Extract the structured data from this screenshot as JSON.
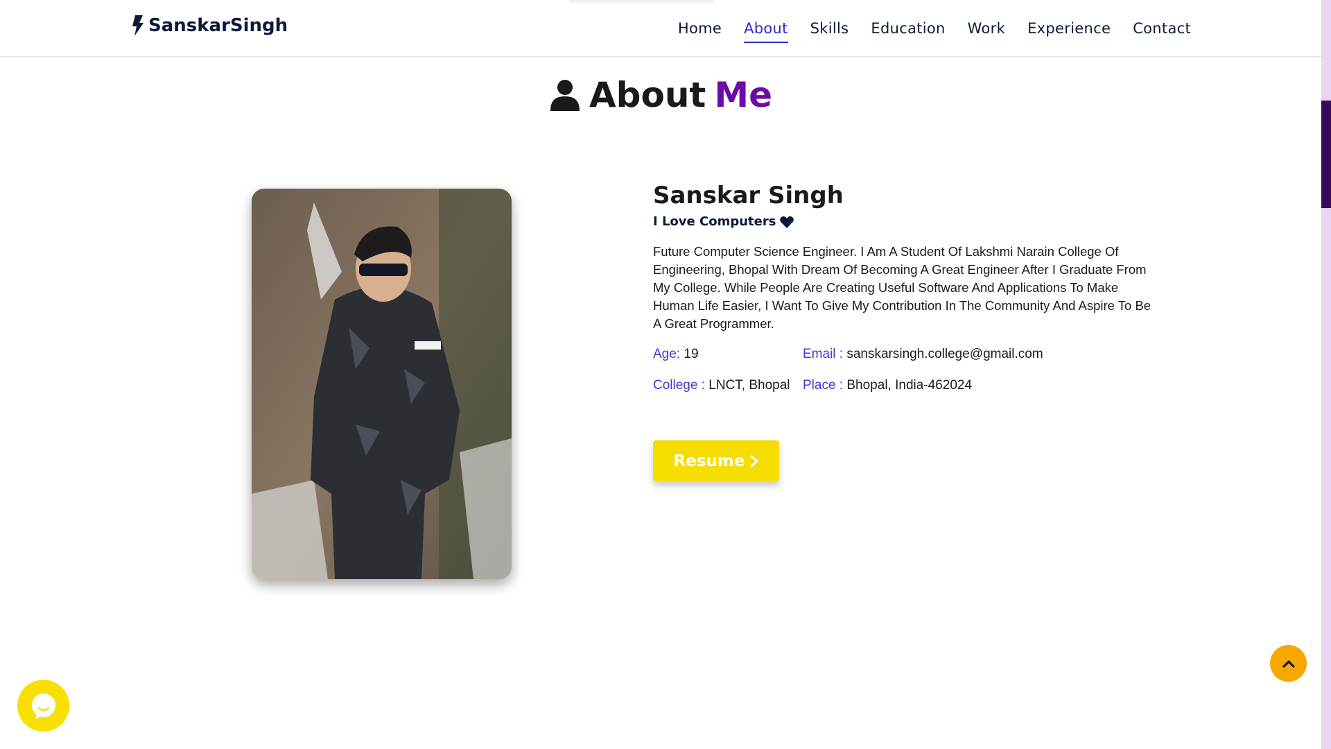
{
  "brand": {
    "name": "SanskarSingh",
    "icon": "bolt-icon"
  },
  "nav": {
    "items": [
      {
        "label": "Home",
        "active": false
      },
      {
        "label": "About",
        "active": true
      },
      {
        "label": "Skills",
        "active": false
      },
      {
        "label": "Education",
        "active": false
      },
      {
        "label": "Work",
        "active": false
      },
      {
        "label": "Experience",
        "active": false
      },
      {
        "label": "Contact",
        "active": false
      }
    ]
  },
  "section": {
    "icon": "user-icon",
    "title": "About",
    "title_accent": "Me",
    "accent_color": "#6c0aa8"
  },
  "profile": {
    "name": "Sanskar Singh",
    "tagline": "I Love Computers",
    "tagline_icon": "heart-icon",
    "description": "Future Computer Science Engineer. I Am A Student Of Lakshmi Narain College Of Engineering, Bhopal With Dream Of Becoming A Great Engineer After I Graduate From My College. While People Are Creating Useful Software And Applications To Make Human Life Easier, I Want To Give My Contribution In The Community And Aspire To Be A Great Programmer.",
    "age_label": "Age:",
    "age_value": "19",
    "email_label": "Email :",
    "email_value": "sanskarsingh.college@gmail.com",
    "college_label": "College :",
    "college_value": "LNCT, Bhopal",
    "place_label": "Place :",
    "place_value": "Bhopal, India-462024",
    "resume_label": "Resume",
    "resume_icon": "chevron-right-icon"
  },
  "colors": {
    "link_active": "#2c2cd1",
    "button_yellow": "#f5dd00",
    "scroll_top_orange": "#f6a800",
    "scrollbar_thumb": "#3a0b5c",
    "scrollbar_track": "#ead4f4"
  },
  "floating": {
    "scroll_top_icon": "chevron-up-icon",
    "chat_icon": "chat-bubble-icon"
  }
}
